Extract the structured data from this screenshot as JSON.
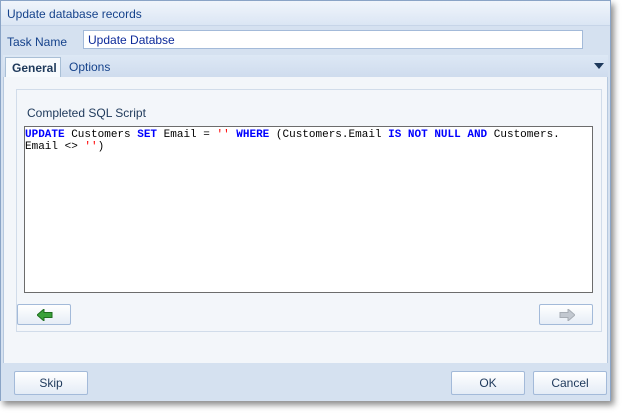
{
  "window": {
    "title": "Update database records"
  },
  "task": {
    "label": "Task Name",
    "value": "Update Databse"
  },
  "tabs": [
    {
      "label": "General",
      "active": true
    },
    {
      "label": "Options",
      "active": false
    }
  ],
  "general": {
    "sql_caption": "Completed SQL Script",
    "sql": {
      "line1_parts": [
        "UPDATE",
        " Customers ",
        "SET",
        " Email = ",
        "''",
        " ",
        "WHERE",
        " (Customers.Email ",
        "IS NOT NULL",
        " ",
        "AND",
        " Customers."
      ],
      "line2_parts": [
        "Email <> ",
        "''",
        ")"
      ]
    }
  },
  "buttons": {
    "skip": "Skip",
    "ok": "OK",
    "cancel": "Cancel"
  },
  "icons": {
    "back": "arrow-left-green-icon",
    "forward": "arrow-right-gray-icon",
    "tab_menu": "triangle-down-icon"
  },
  "colors": {
    "keyword": "#0000ff",
    "string": "#ff0000",
    "back_arrow": "#3aa13a",
    "forward_arrow": "#c2c8d0"
  }
}
